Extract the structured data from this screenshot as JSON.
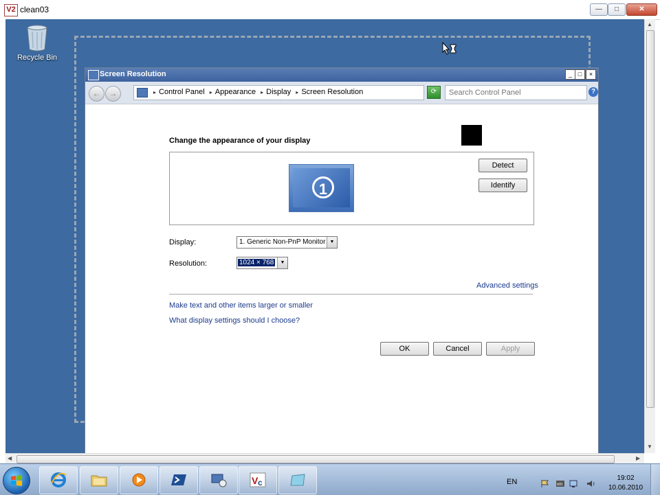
{
  "vnc_window": {
    "title": "clean03",
    "logo_text": "V2",
    "minimize": "—",
    "maximize": "□",
    "close": "✕"
  },
  "desktop": {
    "recycle_bin_label": "Recycle Bin",
    "background_color": "#3c6aa1"
  },
  "window": {
    "title": "Screen Resolution",
    "address_crumbs": [
      "Control Panel",
      "Appearance",
      "Display",
      "Screen Resolution"
    ],
    "search_placeholder": "Search Control Panel"
  },
  "content": {
    "heading": "Change the appearance of your display",
    "monitor_number": "1",
    "detect_label": "Detect",
    "identify_label": "Identify",
    "display_label": "Display:",
    "display_value": "1. Generic Non-PnP Monitor",
    "resolution_label": "Resolution:",
    "resolution_value": "1024 × 768",
    "advanced_settings": "Advanced settings",
    "text_size_link": "Make text and other items larger or smaller",
    "help_link": "What display settings should I choose?",
    "ok_label": "OK",
    "cancel_label": "Cancel",
    "apply_label": "Apply"
  },
  "taskbar": {
    "language": "EN",
    "time": "19:02",
    "date": "10.06.2010",
    "items": [
      "internet-explorer",
      "windows-explorer",
      "media-player",
      "powershell",
      "remote-desktop",
      "vnc-viewer",
      "application"
    ]
  },
  "colors": {
    "link": "#1a3a8c",
    "window_title": "#3d62a0",
    "selection": "#0a246a"
  }
}
